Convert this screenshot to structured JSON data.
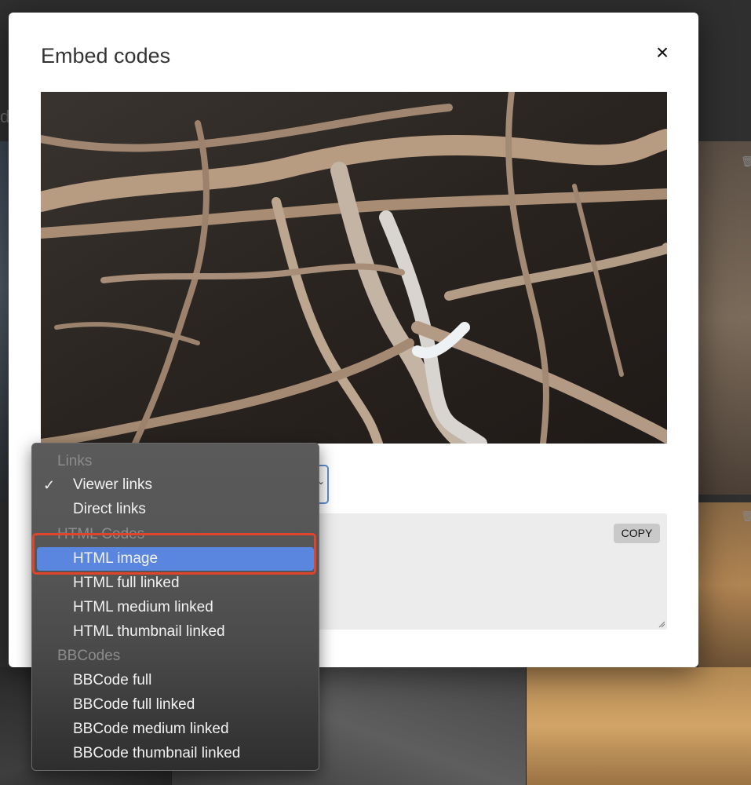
{
  "modal": {
    "title": "Embed codes",
    "close_icon": "close-icon",
    "copy_label": "COPY",
    "select_icon": "chevron-down-icon"
  },
  "background": {
    "partial_text": "d",
    "trash_icon": "trash-icon"
  },
  "dropdown": {
    "groups": [
      {
        "label": "Links",
        "options": [
          {
            "label": "Viewer links",
            "checked": true
          },
          {
            "label": "Direct links",
            "checked": false
          }
        ]
      },
      {
        "label": "HTML Codes",
        "options": [
          {
            "label": "HTML image",
            "highlighted": true
          },
          {
            "label": "HTML full linked"
          },
          {
            "label": "HTML medium linked"
          },
          {
            "label": "HTML thumbnail linked"
          }
        ]
      },
      {
        "label": "BBCodes",
        "options": [
          {
            "label": "BBCode full"
          },
          {
            "label": "BBCode full linked"
          },
          {
            "label": "BBCode medium linked"
          },
          {
            "label": "BBCode thumbnail linked"
          }
        ]
      }
    ],
    "check_glyph": "✓",
    "highlight_color": "#5b86e0",
    "annotation_color": "#e0442c"
  }
}
